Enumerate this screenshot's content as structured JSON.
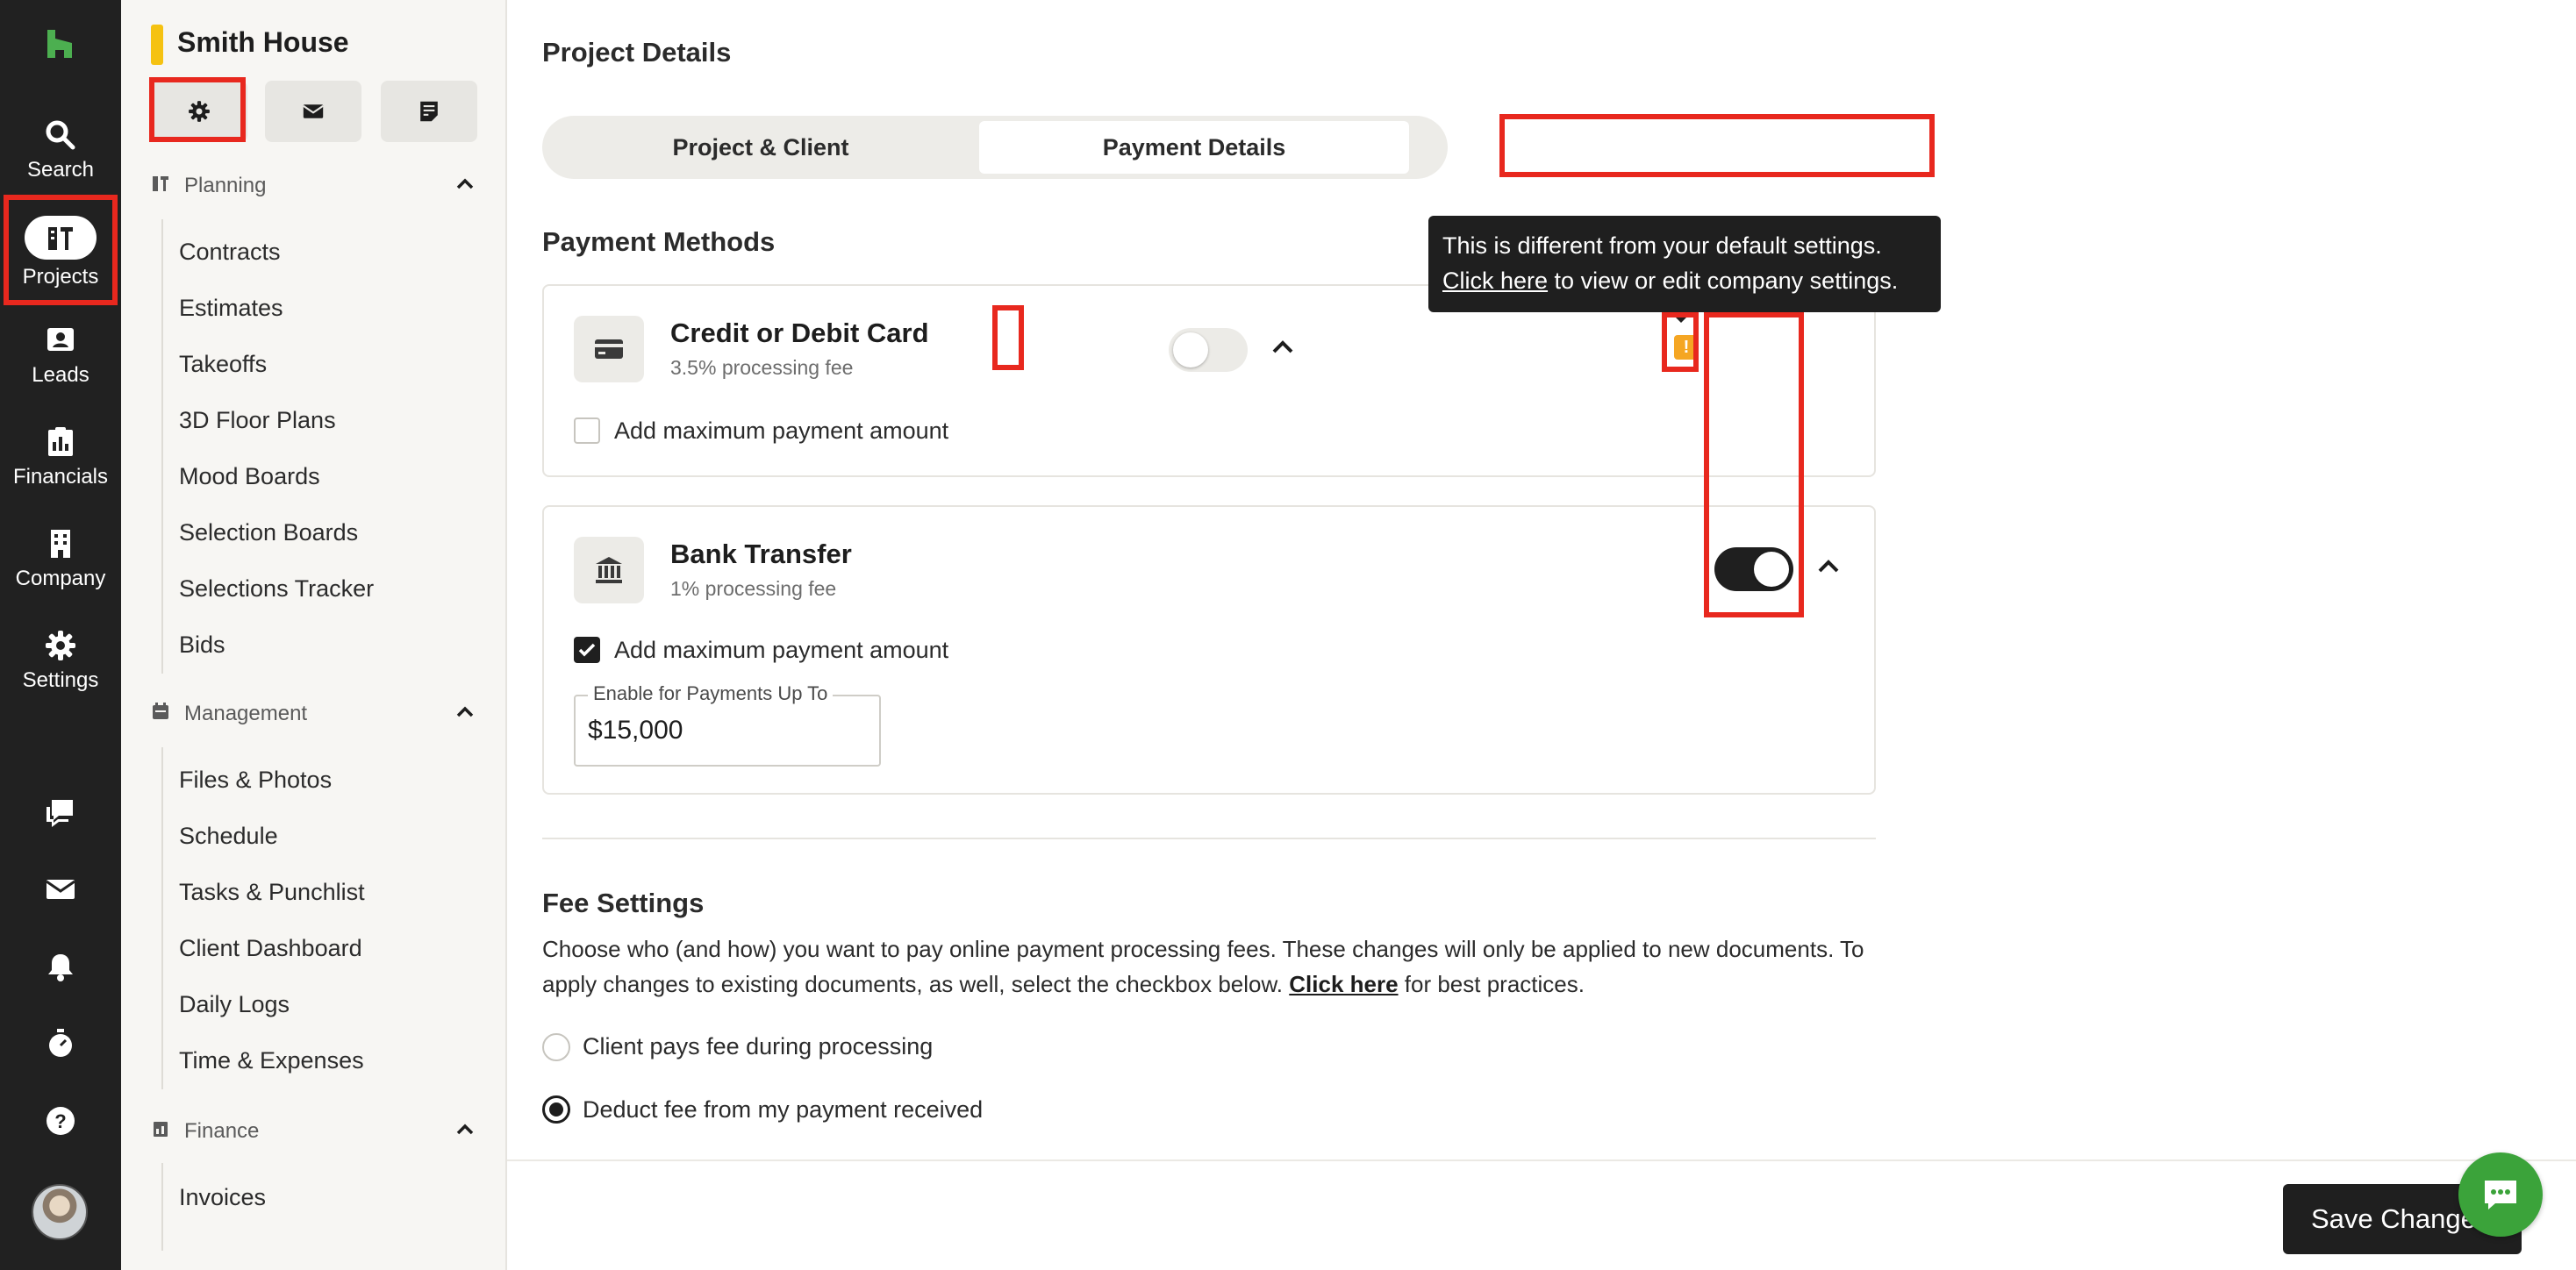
{
  "rail": {
    "items": [
      {
        "label": "Search",
        "icon": "search-icon"
      },
      {
        "label": "Projects",
        "icon": "projects-icon"
      },
      {
        "label": "Leads",
        "icon": "leads-icon"
      },
      {
        "label": "Financials",
        "icon": "financials-icon"
      },
      {
        "label": "Company",
        "icon": "company-icon"
      },
      {
        "label": "Settings",
        "icon": "settings-icon"
      }
    ],
    "bottom_icons": [
      "chat-icon",
      "mail-icon",
      "bell-icon",
      "timer-icon",
      "help-icon"
    ],
    "brand_color": "#4caf50"
  },
  "sidebar": {
    "project_title": "Smith House",
    "project_color": "#f5c211",
    "buttons": [
      "gear-icon",
      "mail-icon",
      "document-icon"
    ],
    "sections": [
      {
        "title": "Planning",
        "items": [
          "Contracts",
          "Estimates",
          "Takeoffs",
          "3D Floor Plans",
          "Mood Boards",
          "Selection Boards",
          "Selections Tracker",
          "Bids"
        ]
      },
      {
        "title": "Management",
        "items": [
          "Files & Photos",
          "Schedule",
          "Tasks & Punchlist",
          "Client Dashboard",
          "Daily Logs",
          "Time & Expenses"
        ]
      },
      {
        "title": "Finance",
        "items": [
          "Invoices"
        ]
      }
    ]
  },
  "main": {
    "page_title": "Project Details",
    "tabs": [
      {
        "label": "Project & Client",
        "active": false
      },
      {
        "label": "Payment Details",
        "active": true
      }
    ],
    "payment_methods_title": "Payment Methods",
    "methods": [
      {
        "title": "Credit or Debit Card",
        "fee": "3.5% processing fee",
        "enabled": false,
        "max_amount_label": "Add maximum payment amount",
        "max_amount_checked": false
      },
      {
        "title": "Bank Transfer",
        "fee": "1% processing fee",
        "enabled": true,
        "max_amount_label": "Add maximum payment amount",
        "max_amount_checked": true,
        "amount_field_label": "Enable for Payments Up To",
        "amount_value": "$15,000"
      }
    ],
    "tooltip": {
      "line1": "This is different from your default settings.",
      "link": "Click here",
      "line2_rest": " to view or edit company settings."
    },
    "fee_settings": {
      "title": "Fee Settings",
      "desc_before": "Choose who (and how) you want to pay online payment processing fees. These changes will only be applied to new documents. To apply changes to existing documents, as well, select the checkbox below. ",
      "desc_link": "Click here",
      "desc_after": " for best practices.",
      "options": [
        {
          "label": "Client pays fee during processing",
          "selected": false
        },
        {
          "label": "Deduct fee from my payment received",
          "selected": true
        }
      ]
    },
    "save_label": "Save Changes",
    "accent_color": "#e8281e"
  }
}
